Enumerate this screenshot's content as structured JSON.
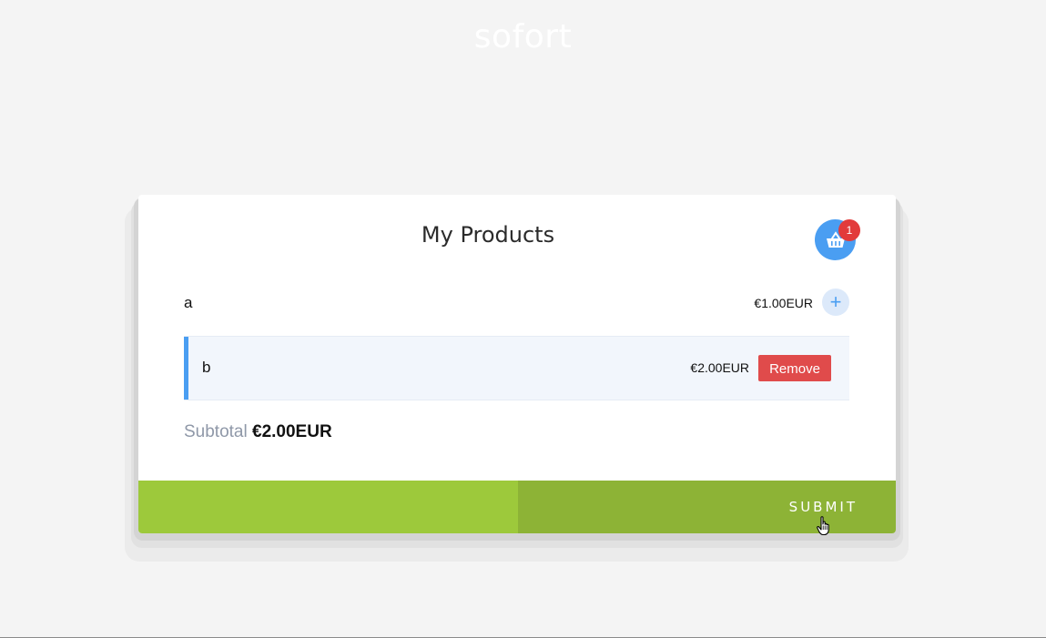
{
  "brand": {
    "name": "sofort"
  },
  "card": {
    "title": "My Products",
    "cart": {
      "count": "1",
      "icon": "basket-icon"
    },
    "products": [
      {
        "name": "a",
        "price": "€1.00EUR",
        "action_label": "+",
        "in_cart": false
      },
      {
        "name": "b",
        "price": "€2.00EUR",
        "action_label": "Remove",
        "in_cart": true
      }
    ],
    "subtotal": {
      "label": "Subtotal",
      "value": "€2.00EUR"
    },
    "submit_label": "SUBMIT"
  },
  "colors": {
    "accent": "#4a9ef2",
    "danger": "#e04b4b",
    "footer_left": "#9dc93b",
    "footer_right": "#8db336",
    "badge": "#e23b3b"
  }
}
